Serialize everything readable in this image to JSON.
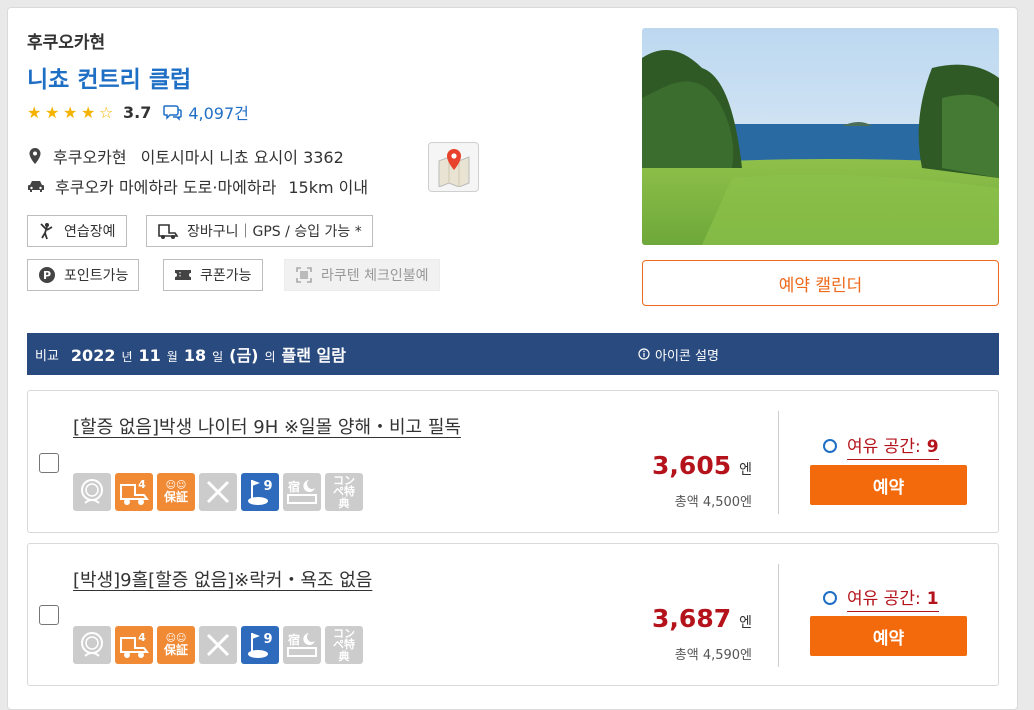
{
  "course": {
    "prefecture": "후쿠오카현",
    "name": "니쵸 컨트리 클럽",
    "rating": "3.7",
    "review_count": "4,097건",
    "address_pref": "후쿠오카현",
    "address": "이토시마시 니쵸 요시이 3362",
    "access_road": "후쿠오카 마에하라 도로·마에하라",
    "access_distance": "15km 이내"
  },
  "tags": {
    "practice": "연습장예",
    "cart": "장바구니｜GPS / 승입 가능 *",
    "points": "포인트가능",
    "coupon": "쿠폰가능",
    "rakuten": "라쿠텐 체크인불예"
  },
  "calendar_button": "예약 캘린더",
  "plan_header": {
    "compare": "비교",
    "year": "2022",
    "year_unit": "년",
    "month": "11",
    "month_unit": "월",
    "day": "18",
    "day_unit": "일",
    "weekday": "(금)",
    "of": "의",
    "title": "플랜 일람",
    "icon_help": "아이콘 설명"
  },
  "plans": [
    {
      "title": "[할증 없음]박생 나이터 9H ※일몰 양해・비고 필독",
      "price": "3,605",
      "unit": "엔",
      "total": "총액 4,500엔",
      "avail_label": "여유 공간:",
      "avail_num": "9",
      "book": "예약"
    },
    {
      "title": "[박생]9홀[할증 없음]※락커・욕조 없음",
      "price": "3,687",
      "unit": "엔",
      "total": "총액 4,590엔",
      "avail_label": "여유 공간:",
      "avail_num": "1",
      "book": "예약"
    }
  ],
  "plan_icons": {
    "cart_number": "4",
    "guarantee": "保証",
    "holes": "9",
    "stay": "宿",
    "compe": "コンペ特典"
  },
  "colors": {
    "accent": "#1f6fc5",
    "orange": "#f26a0c",
    "price": "#b4131b",
    "header_bar": "#294a7e"
  }
}
